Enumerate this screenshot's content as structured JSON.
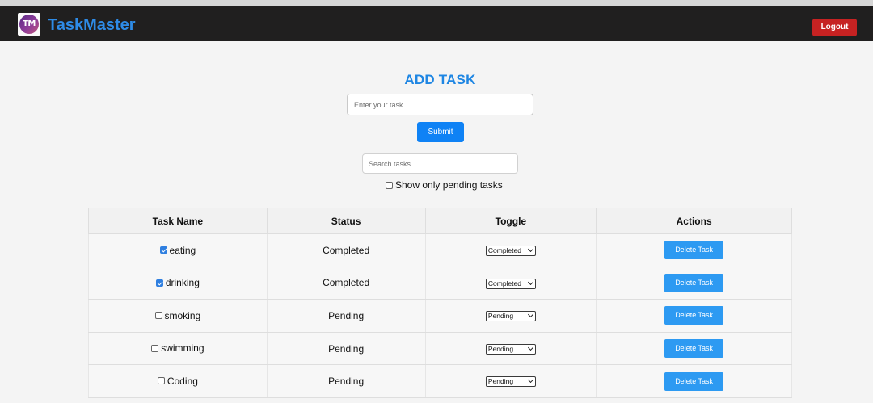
{
  "app": {
    "brand": "TaskMaster",
    "logo_text": "TM",
    "logout_label": "Logout"
  },
  "add_task": {
    "title": "ADD TASK",
    "input_placeholder": "Enter your task...",
    "submit_label": "Submit"
  },
  "search": {
    "placeholder": "Search tasks..."
  },
  "filter": {
    "label": "Show only pending tasks",
    "checked": false
  },
  "table": {
    "headers": [
      "Task Name",
      "Status",
      "Toggle",
      "Actions"
    ],
    "rows": [
      {
        "name": "eating",
        "checked": true,
        "status": "Completed",
        "toggle": "Completed",
        "action": "Delete Task"
      },
      {
        "name": "drinking",
        "checked": true,
        "status": "Completed",
        "toggle": "Completed",
        "action": "Delete Task"
      },
      {
        "name": "smoking",
        "checked": false,
        "status": "Pending",
        "toggle": "Pending",
        "action": "Delete Task"
      },
      {
        "name": "swimming",
        "checked": false,
        "status": "Pending",
        "toggle": "Pending",
        "action": "Delete Task"
      },
      {
        "name": "Coding",
        "checked": false,
        "status": "Pending",
        "toggle": "Pending",
        "action": "Delete Task"
      }
    ]
  },
  "colors": {
    "navbar": "#201f1f",
    "brand": "#2e8be6",
    "logout": "#c62222",
    "primary": "#0f82f5",
    "delete": "#2d9af2"
  }
}
